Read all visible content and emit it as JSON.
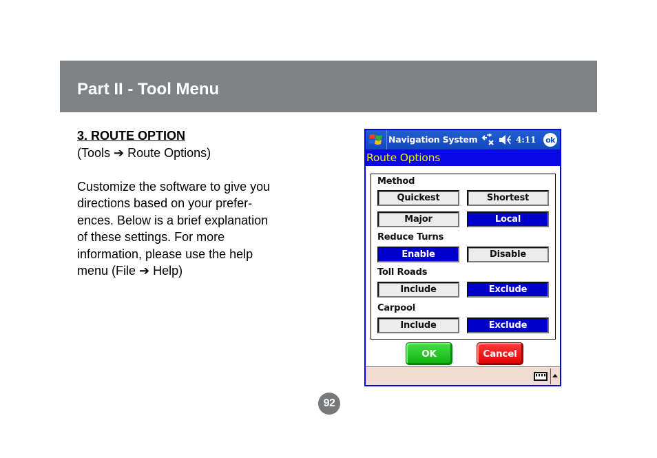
{
  "header": {
    "title": "Part II - Tool Menu"
  },
  "section": {
    "title": "3. ROUTE OPTION",
    "path": "(Tools ➔ Route Options)",
    "body_lines": [
      "Customize the software to give you",
      "directions based on your prefer-",
      "ences.  Below is a brief explanation",
      "of these settings.  For more",
      "information, please use the help",
      "menu (File ➔ Help)"
    ]
  },
  "device": {
    "window_title": "Navigation System",
    "time": "4:11",
    "ok_label": "ok",
    "status_icons": [
      "connectivity-icon",
      "volume-icon"
    ],
    "caption": "Route Options",
    "groups": {
      "method": {
        "label": "Method",
        "options": [
          {
            "label": "Quickest",
            "selected": false
          },
          {
            "label": "Shortest",
            "selected": false
          },
          {
            "label": "Major",
            "selected": false
          },
          {
            "label": "Local",
            "selected": true
          }
        ]
      },
      "reduce_turns": {
        "label": "Reduce Turns",
        "options": [
          {
            "label": "Enable",
            "selected": true
          },
          {
            "label": "Disable",
            "selected": false
          }
        ]
      },
      "toll_roads": {
        "label": "Toll Roads",
        "options": [
          {
            "label": "Include",
            "selected": false
          },
          {
            "label": "Exclude",
            "selected": true
          }
        ]
      },
      "carpool": {
        "label": "Carpool",
        "options": [
          {
            "label": "Include",
            "selected": false
          },
          {
            "label": "Exclude",
            "selected": true
          }
        ]
      }
    },
    "buttons": {
      "ok": "OK",
      "cancel": "Cancel"
    },
    "colors": {
      "selected": "#0000cc",
      "caption_bg": "#0a08e6",
      "caption_text": "#f2f200",
      "ok_btn": "#22c422",
      "cancel_btn": "#f01010"
    }
  },
  "page_number": "92"
}
